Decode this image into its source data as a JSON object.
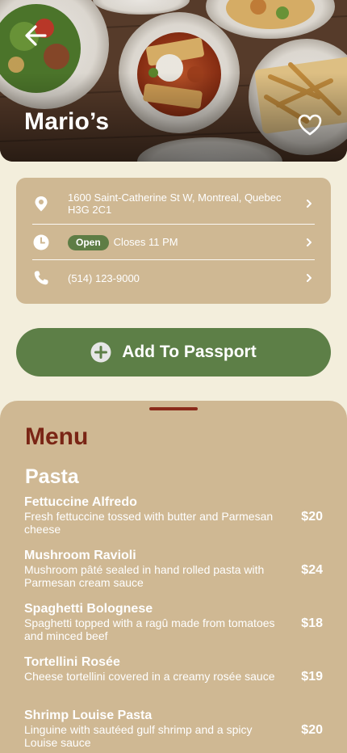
{
  "restaurant": {
    "name": "Mario’s"
  },
  "info": {
    "address": "1600 Saint-Catherine St W, Montreal, Quebec H3G 2C1",
    "status_badge": "Open",
    "hours_text": "Closes 11 PM",
    "phone": "(514) 123-9000"
  },
  "actions": {
    "add_label": "Add To Passport"
  },
  "menu": {
    "title": "Menu",
    "section": "Pasta",
    "items": [
      {
        "name": "Fettuccine Alfredo",
        "desc": "Fresh fettuccine tossed with butter and Parmesan cheese",
        "price": "$20"
      },
      {
        "name": "Mushroom Ravioli",
        "desc": "Mushroom pâté sealed in hand rolled pasta with Parmesan cream sauce",
        "price": "$24"
      },
      {
        "name": "Spaghetti Bolognese",
        "desc": "Spaghetti topped with a ragû made from tomatoes and minced beef",
        "price": "$18"
      },
      {
        "name": "Tortellini Rosée",
        "desc": "Cheese tortellini covered in a creamy rosée sauce",
        "price": "$19"
      },
      {
        "name": "Shrimp Louise Pasta",
        "desc": "Linguine with sautéed gulf shrimp and a spicy Louise sauce",
        "price": "$20"
      }
    ]
  },
  "icons": {
    "back": "arrow-left-icon",
    "favorite": "heart-icon",
    "location": "map-pin-icon",
    "clock": "clock-icon",
    "phone": "phone-icon",
    "chevron": "chevron-right-icon",
    "add": "plus-circle-icon"
  },
  "colors": {
    "background": "#f3eedc",
    "card": "#cfb893",
    "accent_green": "#5d7f47",
    "menu_title": "#7a2515"
  }
}
